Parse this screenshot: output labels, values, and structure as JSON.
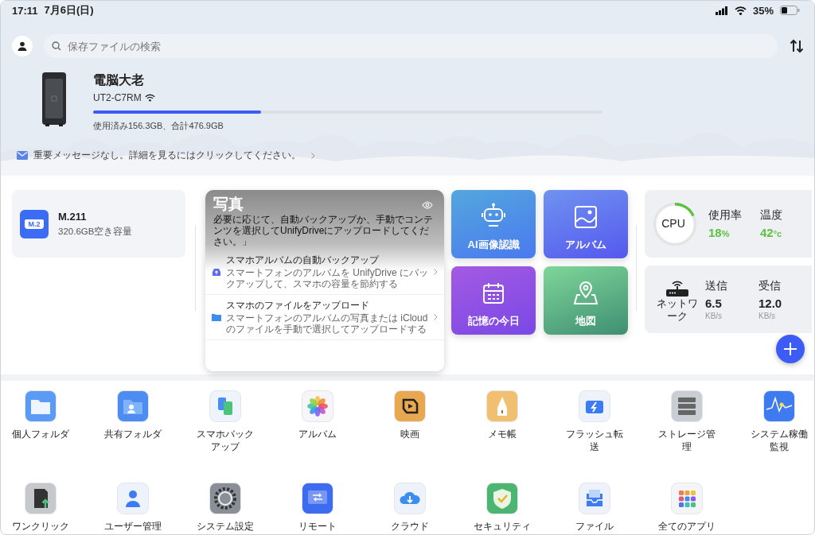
{
  "status_bar": {
    "time": "17:11",
    "date": "7月6日(日)",
    "battery": "35%"
  },
  "header": {
    "search": {
      "placeholder": "保存ファイルの検索"
    }
  },
  "device": {
    "name": "電脳大老",
    "model": "UT2-C7RM",
    "storage": {
      "level": 0.33,
      "text": "使用済み156.3GB、合計476.9GB"
    },
    "message": "重要メッセージなし。詳細を見るにはクリックしてください。"
  },
  "drive": {
    "icon_text": "M.2",
    "name": "M.211",
    "free": "320.6GB空き容量"
  },
  "photos": {
    "title": "写真",
    "description": "必要に応じて、自動バックアップか、手動でコンテンツを選択してUnifyDriveにアップロードしてください。」",
    "items": [
      {
        "kind": "cloud",
        "title": "スマホアルバムの自動バックアップ",
        "subtitle": "スマートフォンのアルバムを UnifyDrive にバックアップして、スマホの容量を節約する"
      },
      {
        "kind": "folder",
        "title": "スマホのファイルをアップロード",
        "subtitle": "スマートフォンのアルバムの写真または iCloud のファイルを手動で選択してアップロードする"
      }
    ]
  },
  "tiles": [
    {
      "kind": "robot",
      "label": "AI画像認識"
    },
    {
      "kind": "album",
      "label": "アルバム"
    },
    {
      "kind": "calendar",
      "label": "記憶の今日"
    },
    {
      "kind": "map",
      "label": "地図"
    }
  ],
  "cpu": {
    "label": "CPU",
    "level": 0.18,
    "metrics": [
      {
        "label": "使用率",
        "value": "18",
        "unit": "%"
      },
      {
        "label": "温度",
        "value": "42",
        "unit": "°c"
      }
    ]
  },
  "network": {
    "label": "ネットワーク",
    "metrics": [
      {
        "label": "送信",
        "value": "6.5",
        "unit": "KB/s"
      },
      {
        "label": "受信",
        "value": "12.0",
        "unit": "KB/s"
      }
    ]
  },
  "apps": [
    {
      "kind": "folder",
      "label": "個人フォルダ"
    },
    {
      "kind": "shared",
      "label": "共有フォルダ"
    },
    {
      "kind": "backup",
      "label": "スマホバックアップ"
    },
    {
      "kind": "photos",
      "label": "アルバム"
    },
    {
      "kind": "movie",
      "label": "映画"
    },
    {
      "kind": "notes",
      "label": "メモ帳"
    },
    {
      "kind": "flash",
      "label": "フラッシュ転送"
    },
    {
      "kind": "storage",
      "label": "ストレージ管理"
    },
    {
      "kind": "monitor",
      "label": "システム稼働監視"
    },
    {
      "kind": "sdcard",
      "label": "ワンクリック"
    },
    {
      "kind": "user",
      "label": "ユーザー管理"
    },
    {
      "kind": "gear",
      "label": "システム設定"
    },
    {
      "kind": "remote",
      "label": "リモート"
    },
    {
      "kind": "cloud",
      "label": "クラウド"
    },
    {
      "kind": "shield",
      "label": "セキュリティ"
    },
    {
      "kind": "inbox",
      "label": "ファイル"
    },
    {
      "kind": "apps",
      "label": "全てのアプリ"
    }
  ]
}
